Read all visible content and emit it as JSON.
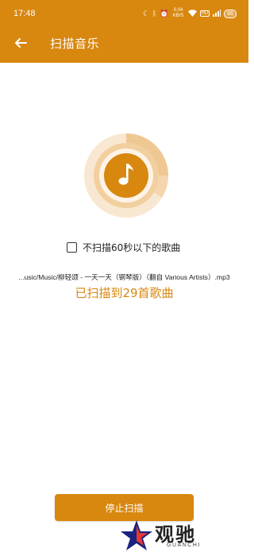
{
  "status_bar": {
    "time": "17:48",
    "speed": "0.04 KB/S",
    "battery": "86",
    "icons": [
      "moon-icon",
      "bluetooth-icon",
      "alarm-icon",
      "wifi-icon",
      "hd-icon",
      "signal-icon"
    ]
  },
  "header": {
    "title": "扫描音乐",
    "back_icon": "arrow-left-icon"
  },
  "scan": {
    "music_icon": "music-note-icon",
    "filter_label": "不扫描60秒以下的歌曲",
    "filter_checked": false,
    "current_file": "...usic/Music/柳轻颂 - 一天一天（钢琴版）（翻自 Various Artists）.mp3",
    "count_text": "已扫描到29首歌曲"
  },
  "actions": {
    "stop_label": "停止扫描"
  },
  "watermark": {
    "text": "观驰",
    "sub": "GUANCHI"
  },
  "colors": {
    "accent": "#d8870f",
    "ring_outer": "#f8e6cc",
    "ring_mid": "#efc793",
    "ring_inner": "#e6a551"
  }
}
